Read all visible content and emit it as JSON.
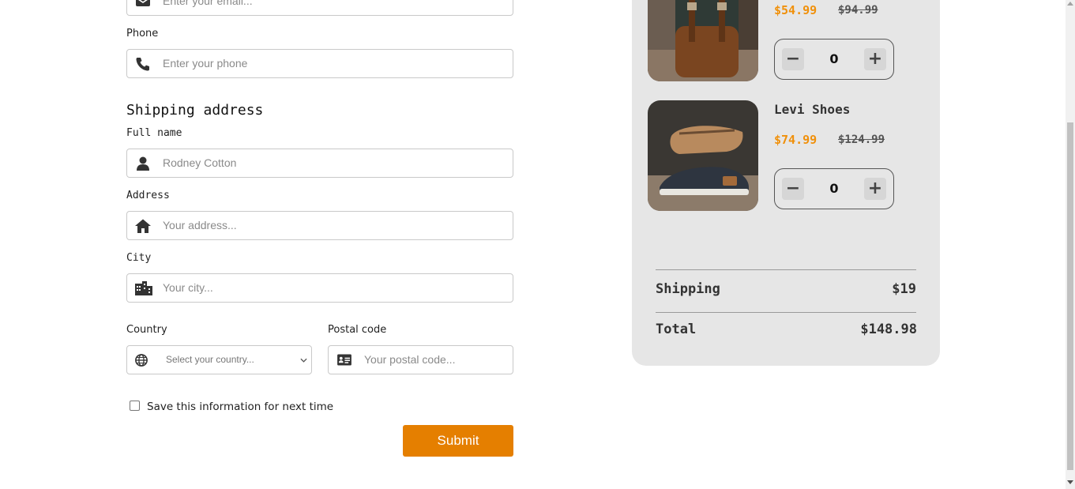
{
  "form": {
    "email_placeholder": "Enter your email...",
    "phone_label": "Phone",
    "phone_placeholder": "Enter your phone",
    "shipping_heading": "Shipping address",
    "fullname_label": "Full name",
    "fullname_placeholder": "Rodney Cotton",
    "address_label": "Address",
    "address_placeholder": "Your address...",
    "city_label": "City",
    "city_placeholder": "Your city...",
    "country_label": "Country",
    "country_placeholder": "Select your country...",
    "postal_label": "Postal code",
    "postal_placeholder": "Your postal code...",
    "save_label": "Save this information for next time",
    "submit_label": "Submit"
  },
  "cart": {
    "items": [
      {
        "name": "",
        "price": "$54.99",
        "old_price": "$94.99",
        "qty": "0",
        "image": "leather-backpack"
      },
      {
        "name": "Levi Shoes",
        "price": "$74.99",
        "old_price": "$124.99",
        "qty": "0",
        "image": "canvas-shoe"
      }
    ],
    "shipping_label": "Shipping",
    "shipping_value": "$19",
    "total_label": "Total",
    "total_value": "$148.98"
  },
  "colors": {
    "accent": "#e57f00",
    "price": "#f0900a",
    "panel": "#e6e6e6"
  },
  "icons": [
    "envelope-icon",
    "phone-icon",
    "user-icon",
    "home-icon",
    "city-icon",
    "globe-icon",
    "id-card-icon",
    "minus-icon",
    "plus-icon",
    "chevron-down-icon"
  ]
}
